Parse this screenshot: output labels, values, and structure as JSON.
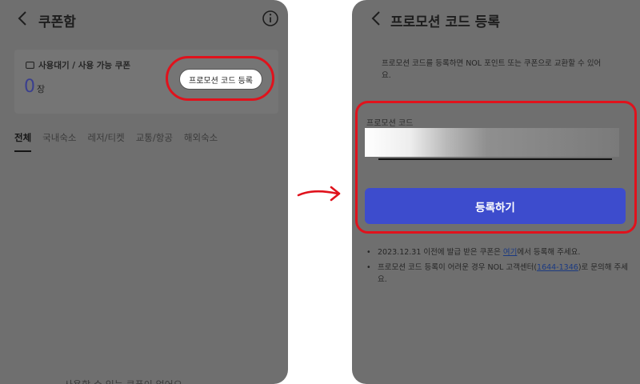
{
  "left_screen": {
    "header": {
      "title": "쿠폰함",
      "back_icon": "chevron-left-icon",
      "info_icon": "info-circle-icon"
    },
    "coupon_card": {
      "label": "사용대기 / 사용 가능 쿠폰",
      "ticket_icon": "ticket-icon",
      "count": "0",
      "count_unit": "장"
    },
    "promo_button_label": "프로모션 코드 등록",
    "tabs": [
      {
        "label": "전체",
        "active": true
      },
      {
        "label": "국내숙소",
        "active": false
      },
      {
        "label": "레저/티켓",
        "active": false
      },
      {
        "label": "교통/항공",
        "active": false
      },
      {
        "label": "해외숙소",
        "active": false
      }
    ],
    "empty_text": "사용할 수 있는 쿠폰이 없어요"
  },
  "right_screen": {
    "header": {
      "title": "프로모션 코드 등록",
      "back_icon": "chevron-left-icon"
    },
    "description": "프로모션 코드를 등록하면 NOL 포인트 또는 쿠폰으로 교환할 수 있어요.",
    "code_field": {
      "label": "프로모션 코드",
      "value": "",
      "placeholder": ""
    },
    "submit_label": "등록하기",
    "notes": [
      {
        "before": "2023.12.31 이전에 발급 받은 쿠폰은 ",
        "link": "여기",
        "after": "에서 등록해 주세요."
      },
      {
        "before": "프로모션 코드 등록이 어려운 경우 NOL 고객센터(",
        "link": "1644-1346",
        "after": ")로 문의해 주세요."
      }
    ]
  },
  "colors": {
    "overlay_gray": "#6f6f6f",
    "primary_button": "#3d4ccd",
    "highlight_red": "#e0121c",
    "count_number": "#3a3f8f"
  }
}
